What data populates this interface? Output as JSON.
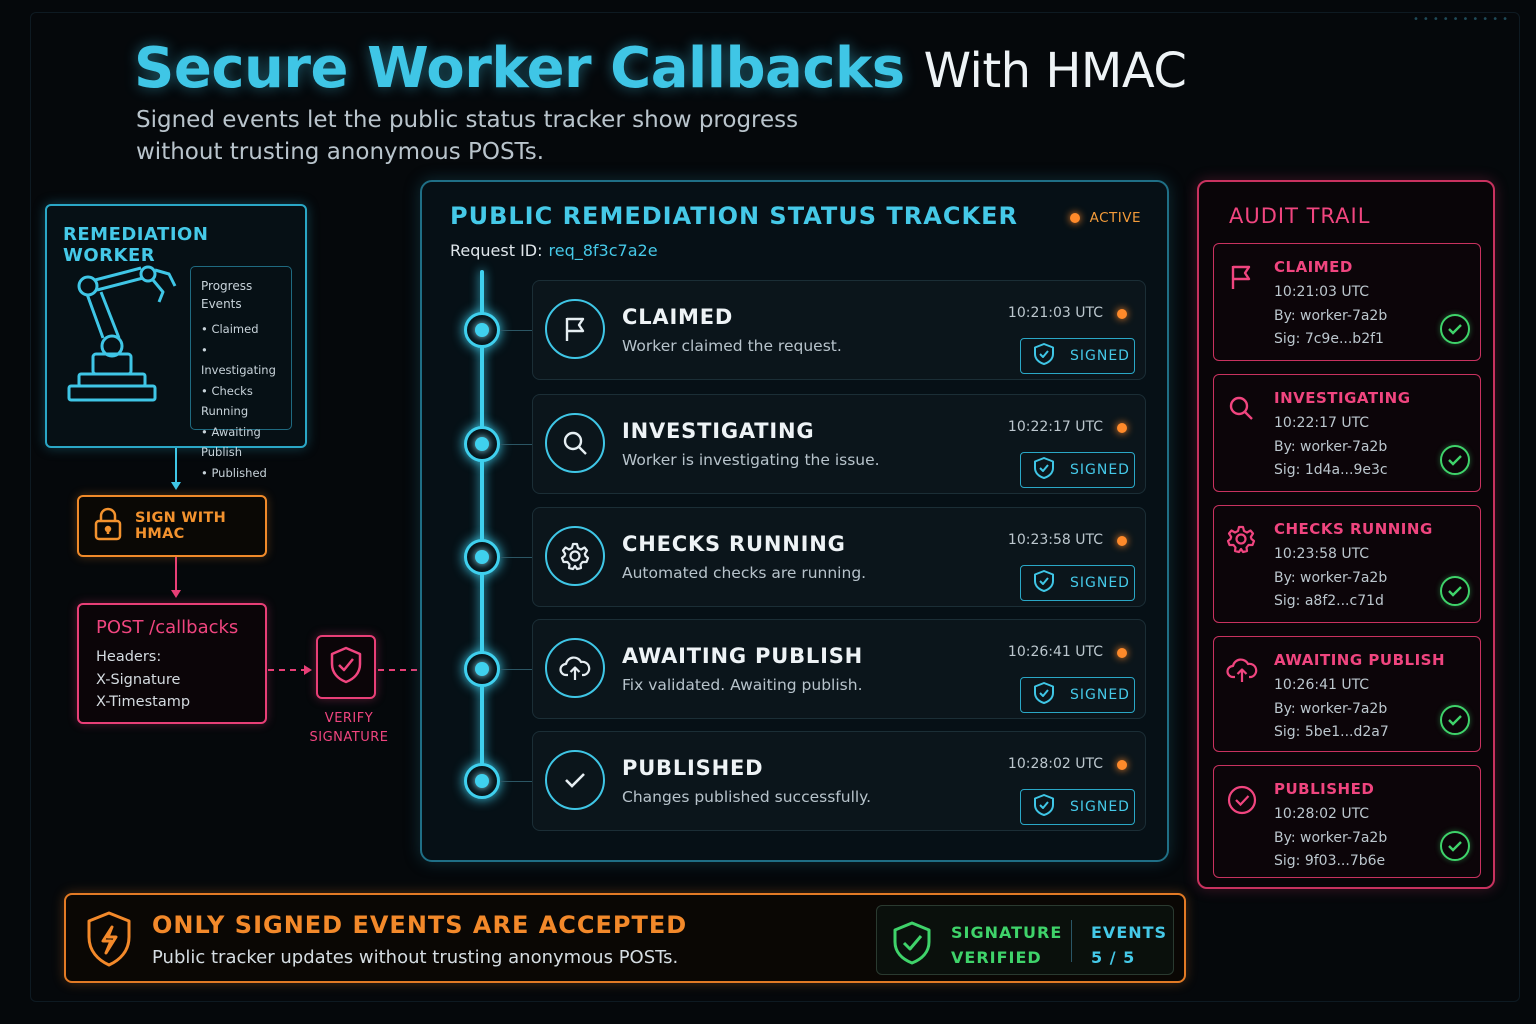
{
  "header": {
    "title_main": "Secure Worker Callbacks",
    "title_rest": "With HMAC",
    "subtitle": "Signed events let the public status tracker show progress without trusting anonymous POSTs."
  },
  "worker": {
    "title": "REMEDIATION WORKER",
    "events_heading": "Progress Events",
    "events": [
      "Claimed",
      "Investigating",
      "Checks Running",
      "Awaiting Publish",
      "Published"
    ]
  },
  "hmac": {
    "label": "SIGN WITH HMAC"
  },
  "post": {
    "title": "POST /callbacks",
    "headers_label": "Headers:",
    "header1": "X-Signature",
    "header2": "X-Timestamp"
  },
  "verify": {
    "label": "VERIFY SIGNATURE"
  },
  "tracker": {
    "title": "PUBLIC REMEDIATION STATUS TRACKER",
    "status": "ACTIVE",
    "request_label": "Request ID:",
    "request_id": "req_8f3c7a2e",
    "signed_label": "SIGNED",
    "steps": [
      {
        "title": "CLAIMED",
        "desc": "Worker claimed the request.",
        "time": "10:21:03 UTC",
        "icon": "flag-icon"
      },
      {
        "title": "INVESTIGATING",
        "desc": "Worker is investigating the issue.",
        "time": "10:22:17 UTC",
        "icon": "search-icon"
      },
      {
        "title": "CHECKS RUNNING",
        "desc": "Automated checks are running.",
        "time": "10:23:58 UTC",
        "icon": "gear-icon"
      },
      {
        "title": "AWAITING PUBLISH",
        "desc": "Fix validated. Awaiting publish.",
        "time": "10:26:41 UTC",
        "icon": "cloud-upload-icon"
      },
      {
        "title": "PUBLISHED",
        "desc": "Changes published successfully.",
        "time": "10:28:02 UTC",
        "icon": "check-icon"
      }
    ]
  },
  "audit": {
    "title": "AUDIT TRAIL",
    "entries": [
      {
        "title": "CLAIMED",
        "time": "10:21:03 UTC",
        "by": "By: worker-7a2b",
        "sig": "Sig: 7c9e...b2f1",
        "icon": "flag-icon"
      },
      {
        "title": "INVESTIGATING",
        "time": "10:22:17 UTC",
        "by": "By: worker-7a2b",
        "sig": "Sig: 1d4a...9e3c",
        "icon": "search-icon"
      },
      {
        "title": "CHECKS RUNNING",
        "time": "10:23:58 UTC",
        "by": "By: worker-7a2b",
        "sig": "Sig: a8f2...c71d",
        "icon": "gear-icon"
      },
      {
        "title": "AWAITING PUBLISH",
        "time": "10:26:41 UTC",
        "by": "By: worker-7a2b",
        "sig": "Sig: 5be1...d2a7",
        "icon": "cloud-upload-icon"
      },
      {
        "title": "PUBLISHED",
        "time": "10:28:02 UTC",
        "by": "By: worker-7a2b",
        "sig": "Sig: 9f03...7b6e",
        "icon": "check-circle-icon"
      }
    ]
  },
  "banner": {
    "title": "ONLY SIGNED EVENTS ARE ACCEPTED",
    "desc": "Public tracker updates without trusting anonymous POSTs.",
    "sig_line1": "SIGNATURE",
    "sig_line2": "VERIFIED",
    "events_label": "EVENTS",
    "events_count": "5 / 5"
  },
  "colors": {
    "cyan": "#3fc6e6",
    "pink": "#f0457f",
    "orange": "#f3892a",
    "green": "#3fd36a",
    "background": "#05080b"
  }
}
